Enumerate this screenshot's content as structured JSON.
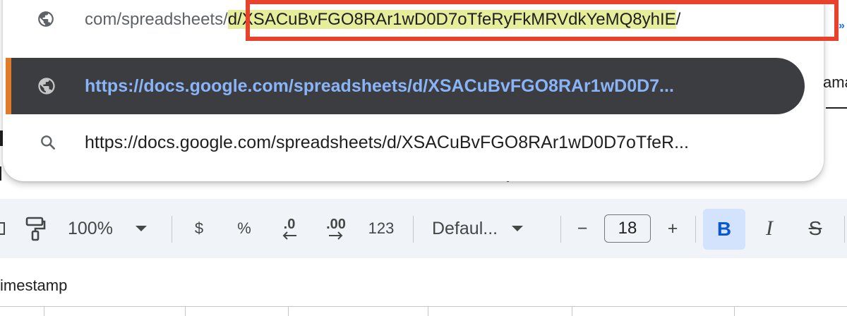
{
  "omnibox": {
    "text_prefix": "com/spreadsheets/",
    "text_selected": "d/XSACuBvFGO8RAr1wD0D7oTfeRyFkMRVdkYeMQ8yhIE",
    "text_suffix": "/",
    "icon": "globe-icon"
  },
  "suggestions": [
    {
      "icon": "globe-icon",
      "text": "https://docs.google.com/spreadsheets/d/XSACuBvFGO8RAr1wD0D7...",
      "selected": true
    },
    {
      "icon": "search-icon",
      "text": "https://docs.google.com/spreadsheets/d/XSACuBvFGO8RAr1wD0D7oTfeR..."
    }
  ],
  "background": {
    "partial_text": "ama"
  },
  "toolbar": {
    "paint_format_icon": "paint-roller-icon",
    "zoom": "100%",
    "currency": "$",
    "percent": "%",
    "decrease_decimal": ".0",
    "increase_decimal": ".00",
    "number_format": "123",
    "font": "Defaul...",
    "decrease_size": "−",
    "font_size": "18",
    "increase_size": "+",
    "bold": "B",
    "italic": "I",
    "strikethrough": "S"
  },
  "sheet": {
    "cell_label": "imestamp"
  },
  "colors": {
    "highlight_box": "#e8412c",
    "selected_row_bg": "#3c3d40",
    "selected_row_text": "#8ab4f8",
    "selection_bg": "#e6ee9c",
    "accent": "#e07b2a"
  }
}
